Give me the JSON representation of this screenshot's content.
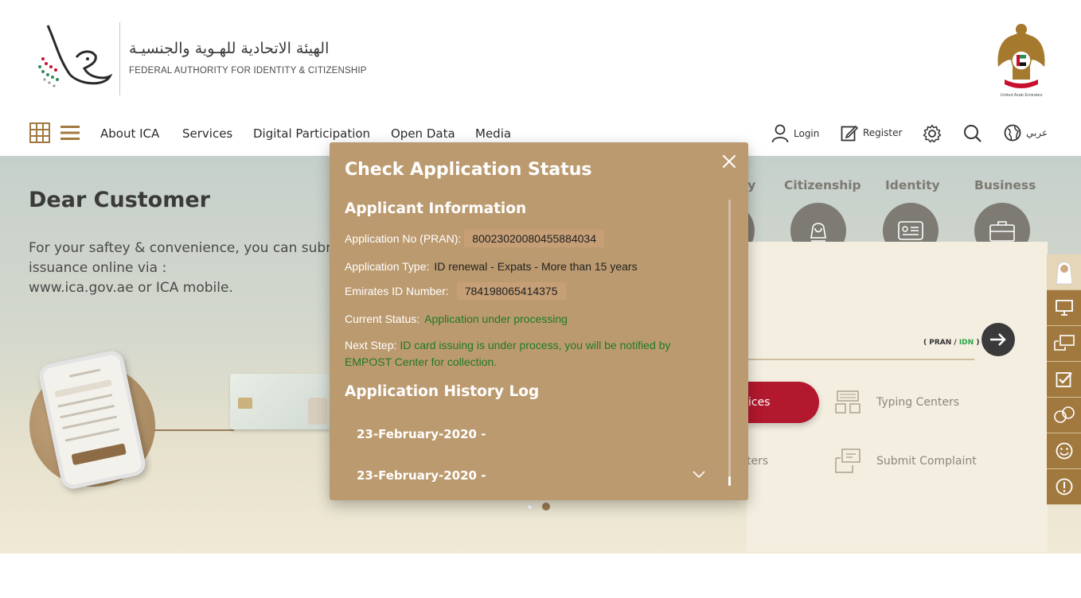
{
  "header": {
    "org_name_ar": "الهيئة الاتحادية للهـوية والجنسيـة",
    "org_name_en": "FEDERAL AUTHORITY FOR IDENTITY & CITIZENSHIP",
    "emblem_caption": "United Arab Emirates"
  },
  "nav": {
    "items": [
      "About ICA",
      "Services",
      "Digital Participation",
      "Open Data",
      "Media"
    ],
    "login": "Login",
    "register": "Register",
    "language": "عربي"
  },
  "hero": {
    "title": "Dear Customer",
    "text_line1": "For your saftey & convenience, you can subm",
    "text_line2": "issuance online via :",
    "text_line3": "www.ica.gov.ae or ICA mobile."
  },
  "categories": {
    "partial": "cy",
    "citizenship": "Citizenship",
    "identity": "Identity",
    "business": "Business"
  },
  "panel": {
    "pran_hint_prefix": "( PRAN / ",
    "pran_hint_idn": "IDN",
    "pran_hint_suffix": " )",
    "red_button_partial": "ices",
    "typing_centers": "Typing Centers",
    "submit_complaint": "Submit Complaint",
    "partial_link": "ters"
  },
  "modal": {
    "title": "Check Application Status",
    "applicant_info_title": "Applicant Information",
    "application_no_label": "Application No (PRAN):",
    "application_no_value": "80023020080455884034",
    "application_type_label": "Application Type:",
    "application_type_value": "ID renewal - Expats - More than 15 years",
    "emirates_id_label": "Emirates ID Number:",
    "emirates_id_value": "784198065414375",
    "current_status_label": "Current Status:",
    "current_status_value": "Application under processing",
    "next_step_label": "Next Step:",
    "next_step_value": "ID card issuing is under process, you will be notified by EMPOST Center for collection.",
    "history_title": "Application History Log",
    "history": [
      "23-February-2020 -",
      "23-February-2020 -"
    ]
  },
  "colors": {
    "modal_bg": "#bc9a6f",
    "accent_brown": "#a1793f",
    "status_green": "#1f7a22",
    "red_button": "#b2182e"
  }
}
